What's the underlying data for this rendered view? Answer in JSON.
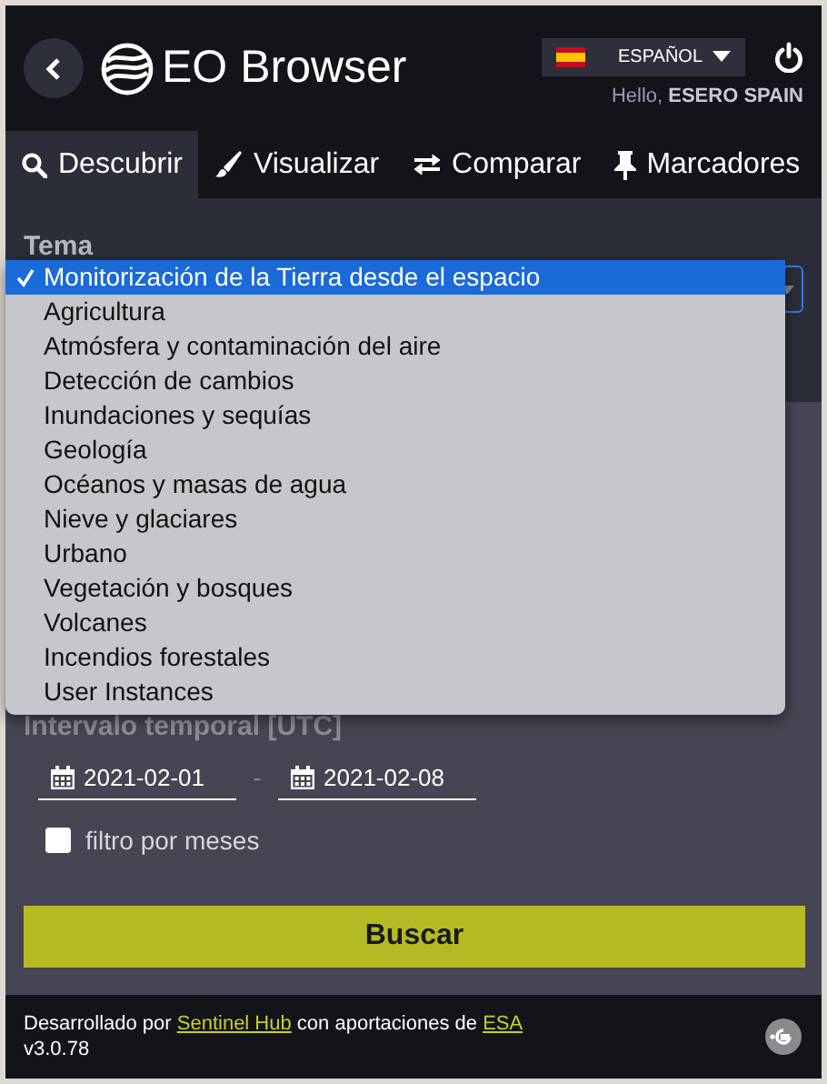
{
  "header": {
    "title": "EO Browser",
    "language": "ESPAÑOL",
    "greeting": "Hello, **ESERO SPAIN**"
  },
  "tabs": [
    {
      "label": "Descubrir",
      "selected": true
    },
    {
      "label": "Visualizar",
      "selected": false
    },
    {
      "label": "Comparar",
      "selected": false
    },
    {
      "label": "Marcadores",
      "selected": false
    }
  ],
  "theme": {
    "label": "Tema",
    "expanded": true,
    "options": [
      {
        "label": "Monitorización de la Tierra desde el espacio",
        "selected": true
      },
      {
        "label": "Agricultura",
        "selected": false
      },
      {
        "label": "Atmósfera y contaminación del aire",
        "selected": false
      },
      {
        "label": "Detección de cambios",
        "selected": false
      },
      {
        "label": "Inundaciones y sequías",
        "selected": false
      },
      {
        "label": "Geología",
        "selected": false
      },
      {
        "label": "Océanos y masas de agua",
        "selected": false
      },
      {
        "label": "Nieve y glaciares",
        "selected": false
      },
      {
        "label": "Urbano",
        "selected": false
      },
      {
        "label": "Vegetación y bosques",
        "selected": false
      },
      {
        "label": "Volcanes",
        "selected": false
      },
      {
        "label": "Incendios forestales",
        "selected": false
      },
      {
        "label": "User Instances",
        "selected": false
      }
    ]
  },
  "time": {
    "label": "Intervalo temporal [UTC]",
    "from": "2021-02-01",
    "separator": "-",
    "to": "2021-02-08"
  },
  "month_filter": {
    "label": "filtro por meses",
    "checked": false
  },
  "search_button": "Buscar",
  "footer": {
    "prefix": "Desarrollado por ",
    "link_1": "Sentinel Hub",
    "middle": " con aportaciones de ",
    "link_2": "ESA",
    "version": "v3.0.78"
  }
}
